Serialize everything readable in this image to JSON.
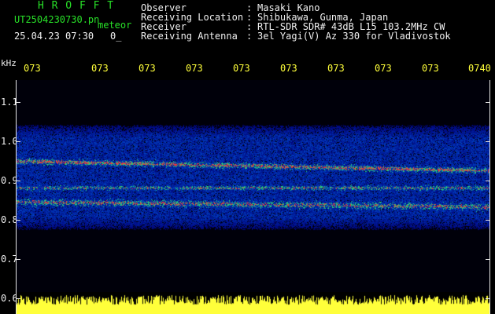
{
  "header": {
    "title": "H R O F F T",
    "filename": "UT2504230730.pn",
    "tag": "meteor",
    "datetime": "25.04.23 07:30",
    "count": "0_"
  },
  "info": {
    "rows": [
      {
        "label": "Observer",
        "value": "Masaki Kano"
      },
      {
        "label": "Receiving Location",
        "value": "Shibukawa, Gunma, Japan"
      },
      {
        "label": "Receiver",
        "value": "RTL-SDR SDR# 43dB L15 103.2MHz CW"
      },
      {
        "label": "Receiving Antenna",
        "value": "3el Yagi(V) Az 330 for Vladivostok"
      }
    ]
  },
  "axis": {
    "unit": "kHz",
    "y_ticks": [
      "1.1",
      "1.0",
      "0.9",
      "0.8",
      "0.7",
      "0.6"
    ],
    "time_ticks": [
      "073",
      "073",
      "073",
      "073",
      "073",
      "073",
      "073",
      "073",
      "073",
      "0740"
    ]
  },
  "colors": {
    "green": "#28e028",
    "white": "#f0f0f0",
    "yellow": "#ffff3a",
    "spectro_blue": "#1030c0",
    "band_red": "#e03030"
  }
}
